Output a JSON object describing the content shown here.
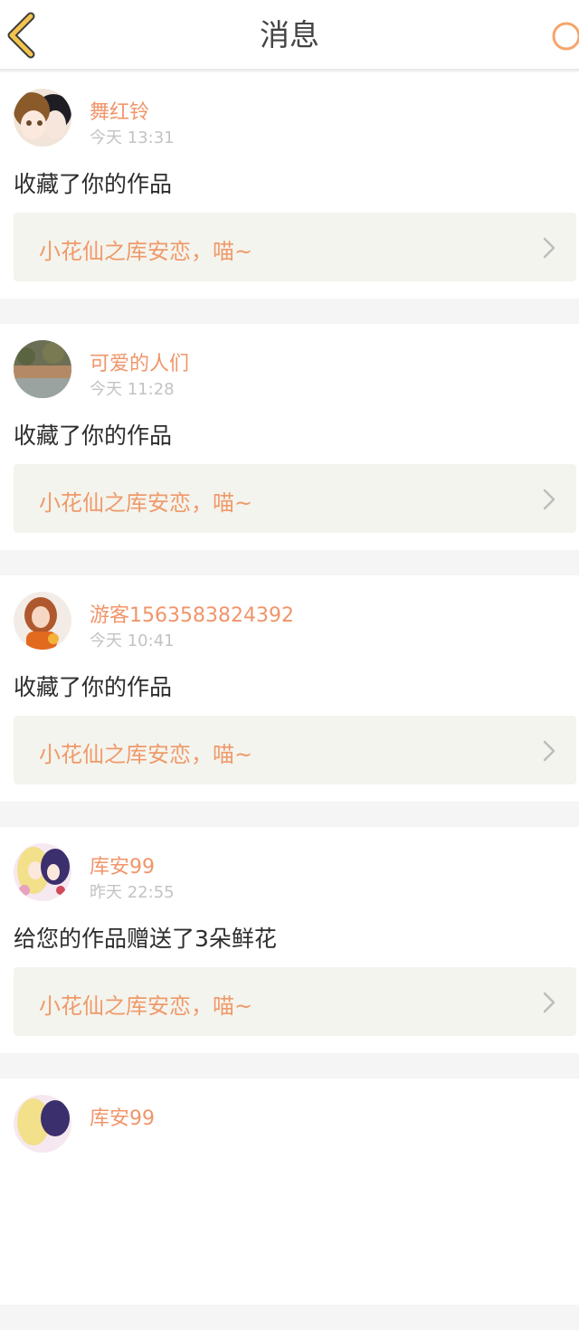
{
  "header": {
    "title": "消息",
    "back_icon": "chevron-left-icon",
    "refresh_icon": "refresh-icon",
    "accent": "#f2c44e",
    "refresh_color": "#f7a46b"
  },
  "messages": [
    {
      "user": "舞红铃",
      "time": "今天 13:31",
      "action": "收藏了你的作品",
      "work": "小花仙之库安恋，喵~"
    },
    {
      "user": "可爱的人们",
      "time": "今天 11:28",
      "action": "收藏了你的作品",
      "work": "小花仙之库安恋，喵~"
    },
    {
      "user": "游客1563583824392",
      "time": "今天 10:41",
      "action": "收藏了你的作品",
      "work": "小花仙之库安恋，喵~"
    },
    {
      "user": "库安99",
      "time": "昨天 22:55",
      "action": "给您的作品赠送了3朵鲜花",
      "work": "小花仙之库安恋，喵~"
    },
    {
      "user": "库安99",
      "time": "",
      "action": "",
      "work": ""
    }
  ],
  "colors": {
    "username": "#f0956a",
    "time": "#c3c3c3",
    "work_title": "#ef9a6a",
    "link_bg": "#f4f4ee",
    "page_bg": "#f5f5f5"
  }
}
